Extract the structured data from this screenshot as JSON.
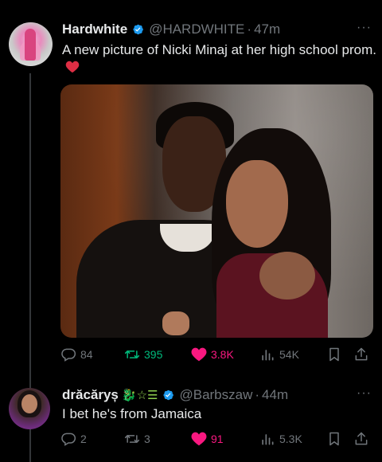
{
  "tweet": {
    "author_name": "Hardwhite",
    "handle": "@HARDWHITE",
    "separator": "·",
    "time": "47m",
    "text": "A new picture of Nicki Minaj at her high school prom.",
    "emoji": "red-heart",
    "stats": {
      "replies": "84",
      "retweets": "395",
      "likes": "3.8K",
      "views": "54K"
    }
  },
  "reply": {
    "author_name": "drăcăryș",
    "name_decoration": "🐉☆☰",
    "handle": "@Barbszaw",
    "separator": "·",
    "time": "44m",
    "text": "I bet he's from Jamaica",
    "stats": {
      "replies": "2",
      "retweets": "3",
      "likes": "91",
      "views": "5.3K"
    }
  },
  "more_label": "···",
  "colors": {
    "background": "#000000",
    "text": "#e7e9ea",
    "muted": "#71767b",
    "verified": "#1d9bf0",
    "like": "#f91880",
    "retweet": "#00ba7c"
  },
  "icons": [
    "verified-badge-icon",
    "reply-icon",
    "retweet-icon",
    "like-icon",
    "views-icon",
    "bookmark-icon",
    "share-icon",
    "more-icon"
  ]
}
